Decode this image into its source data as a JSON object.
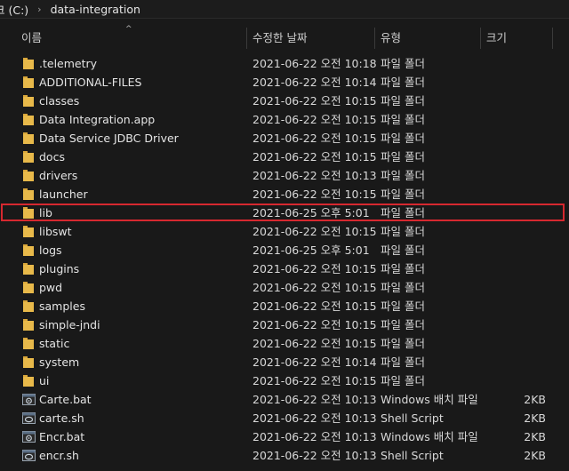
{
  "breadcrumb": {
    "drive": "크 (C:)",
    "separator": "›",
    "folder": "data-integration"
  },
  "columns": {
    "name": "이름",
    "date": "수정한 날짜",
    "type": "유형",
    "size": "크기",
    "sort_indicator": "^"
  },
  "colors": {
    "background": "#191919",
    "folder_icon": "#e8b94a",
    "highlight_border": "#d7282f"
  },
  "rows": [
    {
      "name": ".telemetry",
      "date": "2021-06-22 오전 10:18",
      "type": "파일 폴더",
      "size": "",
      "icon": "folder-icon"
    },
    {
      "name": "ADDITIONAL-FILES",
      "date": "2021-06-22 오전 10:14",
      "type": "파일 폴더",
      "size": "",
      "icon": "folder-icon"
    },
    {
      "name": "classes",
      "date": "2021-06-22 오전 10:15",
      "type": "파일 폴더",
      "size": "",
      "icon": "folder-icon"
    },
    {
      "name": "Data Integration.app",
      "date": "2021-06-22 오전 10:15",
      "type": "파일 폴더",
      "size": "",
      "icon": "folder-icon"
    },
    {
      "name": "Data Service JDBC Driver",
      "date": "2021-06-22 오전 10:15",
      "type": "파일 폴더",
      "size": "",
      "icon": "folder-icon"
    },
    {
      "name": "docs",
      "date": "2021-06-22 오전 10:15",
      "type": "파일 폴더",
      "size": "",
      "icon": "folder-icon"
    },
    {
      "name": "drivers",
      "date": "2021-06-22 오전 10:13",
      "type": "파일 폴더",
      "size": "",
      "icon": "folder-icon"
    },
    {
      "name": "launcher",
      "date": "2021-06-22 오전 10:15",
      "type": "파일 폴더",
      "size": "",
      "icon": "folder-icon"
    },
    {
      "name": "lib",
      "date": "2021-06-25 오후 5:01",
      "type": "파일 폴더",
      "size": "",
      "icon": "folder-icon",
      "highlighted": true
    },
    {
      "name": "libswt",
      "date": "2021-06-22 오전 10:15",
      "type": "파일 폴더",
      "size": "",
      "icon": "folder-icon"
    },
    {
      "name": "logs",
      "date": "2021-06-25 오후 5:01",
      "type": "파일 폴더",
      "size": "",
      "icon": "folder-icon"
    },
    {
      "name": "plugins",
      "date": "2021-06-22 오전 10:15",
      "type": "파일 폴더",
      "size": "",
      "icon": "folder-icon"
    },
    {
      "name": "pwd",
      "date": "2021-06-22 오전 10:15",
      "type": "파일 폴더",
      "size": "",
      "icon": "folder-icon"
    },
    {
      "name": "samples",
      "date": "2021-06-22 오전 10:15",
      "type": "파일 폴더",
      "size": "",
      "icon": "folder-icon"
    },
    {
      "name": "simple-jndi",
      "date": "2021-06-22 오전 10:15",
      "type": "파일 폴더",
      "size": "",
      "icon": "folder-icon"
    },
    {
      "name": "static",
      "date": "2021-06-22 오전 10:15",
      "type": "파일 폴더",
      "size": "",
      "icon": "folder-icon"
    },
    {
      "name": "system",
      "date": "2021-06-22 오전 10:14",
      "type": "파일 폴더",
      "size": "",
      "icon": "folder-icon"
    },
    {
      "name": "ui",
      "date": "2021-06-22 오전 10:15",
      "type": "파일 폴더",
      "size": "",
      "icon": "folder-icon"
    },
    {
      "name": "Carte.bat",
      "date": "2021-06-22 오전 10:13",
      "type": "Windows 배치 파일",
      "size": "2KB",
      "icon": "batch-file-icon"
    },
    {
      "name": "carte.sh",
      "date": "2021-06-22 오전 10:13",
      "type": "Shell Script",
      "size": "2KB",
      "icon": "script-file-icon"
    },
    {
      "name": "Encr.bat",
      "date": "2021-06-22 오전 10:13",
      "type": "Windows 배치 파일",
      "size": "2KB",
      "icon": "batch-file-icon"
    },
    {
      "name": "encr.sh",
      "date": "2021-06-22 오전 10:13",
      "type": "Shell Script",
      "size": "2KB",
      "icon": "script-file-icon"
    }
  ]
}
